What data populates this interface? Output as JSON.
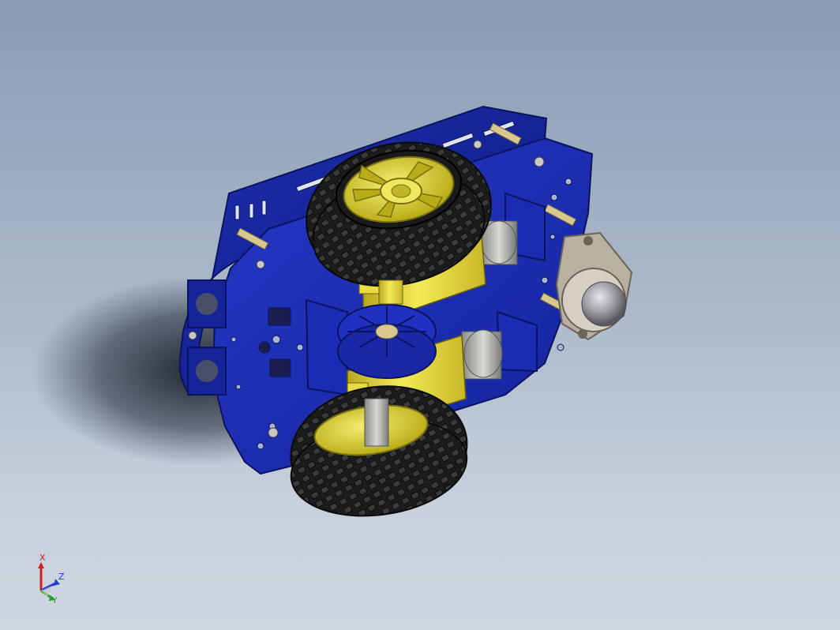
{
  "viewport": {
    "background_top": "#8a9bb2",
    "background_bottom": "#cfd6e0"
  },
  "model": {
    "parts": [
      "chassis-plate-top",
      "chassis-plate-bottom",
      "wheel-left",
      "wheel-right",
      "gear-motor-left",
      "gear-motor-right",
      "encoder-disc",
      "caster-ball",
      "brass-standoffs"
    ],
    "colors": {
      "chassis": "#1a2fb8",
      "chassis_dark": "#0c1a80",
      "wheel_hub": "#e0d82a",
      "motor_body": "#f0e448",
      "tire": "#1e1e1e",
      "caster": "#b8b0a0",
      "standoff": "#d8c890"
    }
  },
  "triad": {
    "x_label": "X",
    "y_label": "Y",
    "z_label": "Z",
    "x_color": "#d02020",
    "y_color": "#20a020",
    "z_color": "#2040d0"
  }
}
